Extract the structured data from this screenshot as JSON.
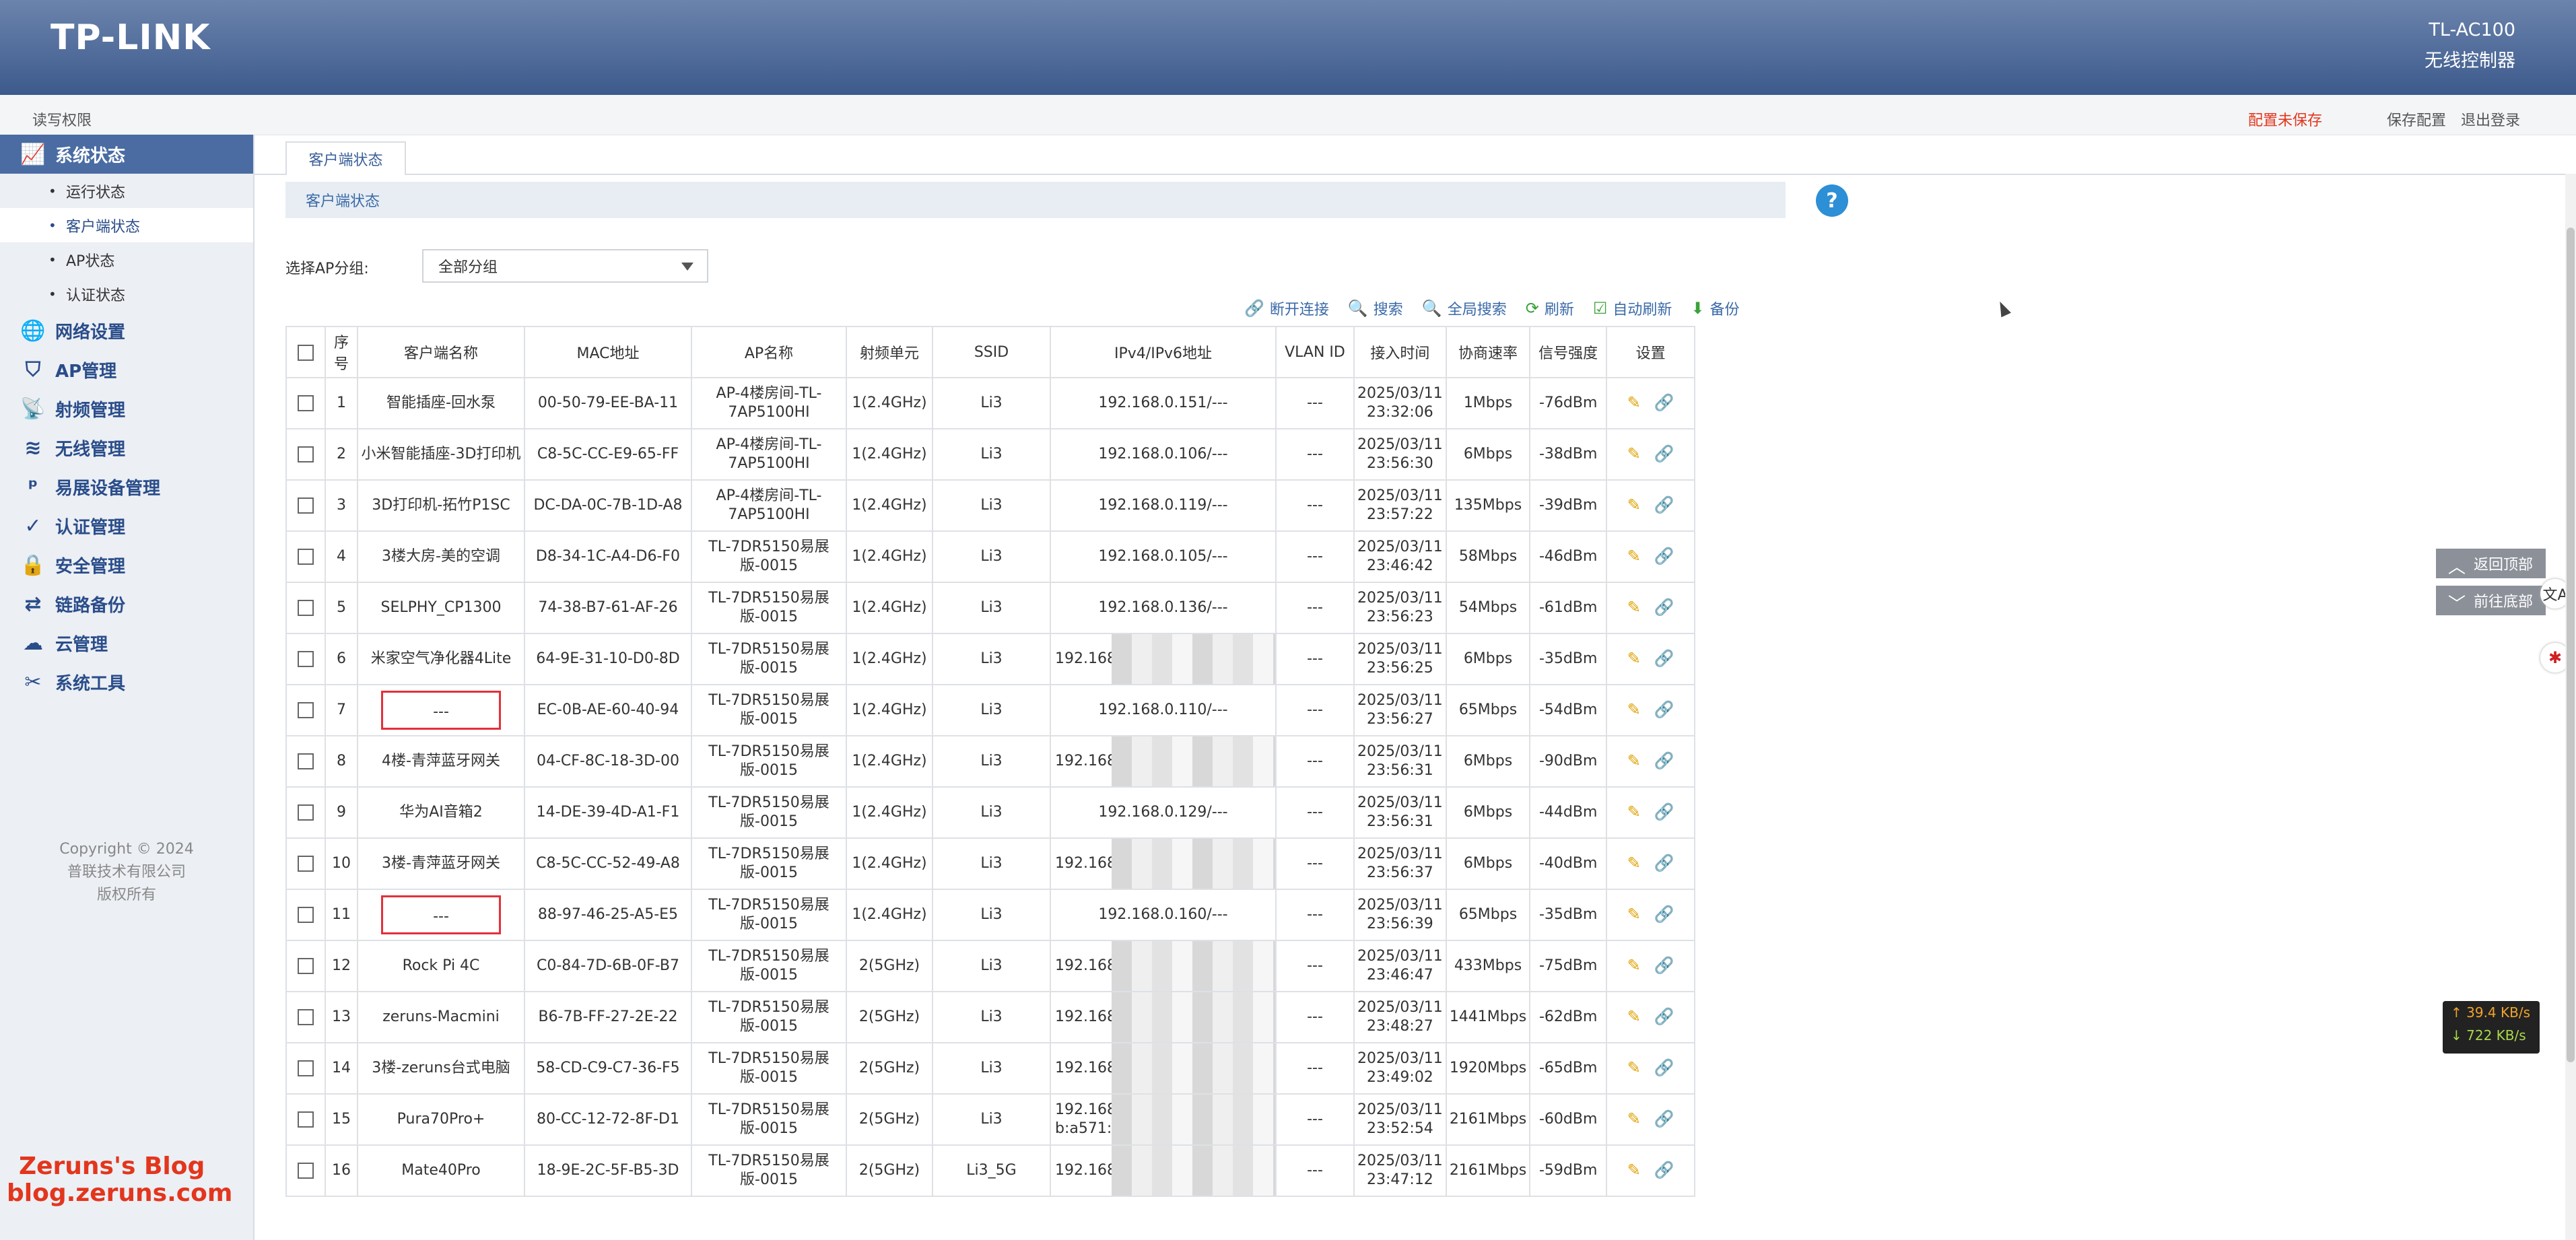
{
  "header": {
    "logo": "TP-LINK",
    "model": "TL-AC100",
    "subtitle": "无线控制器"
  },
  "subbar": {
    "permission": "读写权限",
    "unsaved": "配置未保存",
    "save": "保存配置",
    "logout": "退出登录"
  },
  "sidebar": {
    "items": [
      {
        "label": "系统状态",
        "icon": "chart-line-icon",
        "active": true
      },
      {
        "label": "网络设置",
        "icon": "globe-icon"
      },
      {
        "label": "AP管理",
        "icon": "shield-icon"
      },
      {
        "label": "射频管理",
        "icon": "radio-icon"
      },
      {
        "label": "无线管理",
        "icon": "wifi-icon"
      },
      {
        "label": "易展设备管理",
        "icon": "p-icon"
      },
      {
        "label": "认证管理",
        "icon": "check-shield-icon"
      },
      {
        "label": "安全管理",
        "icon": "lock-icon"
      },
      {
        "label": "链路备份",
        "icon": "shuffle-icon"
      },
      {
        "label": "云管理",
        "icon": "cloud-icon"
      },
      {
        "label": "系统工具",
        "icon": "tools-icon"
      }
    ],
    "subitems": [
      "运行状态",
      "客户端状态",
      "AP状态",
      "认证状态"
    ],
    "copyright": [
      "Copyright © 2024",
      "普联技术有限公司",
      "版权所有"
    ]
  },
  "watermark": {
    "line1": "Zeruns's Blog",
    "line2": "blog.zeruns.com"
  },
  "tabs": {
    "active": "客户端状态"
  },
  "section": {
    "title": "客户端状态"
  },
  "filter": {
    "label": "选择AP分组:",
    "value": "全部分组"
  },
  "toolbar": {
    "disconnect": "断开连接",
    "search": "搜索",
    "global_search": "全局搜索",
    "refresh": "刷新",
    "auto_refresh": "自动刷新",
    "backup": "备份"
  },
  "table": {
    "headers": [
      "序号",
      "客户端名称",
      "MAC地址",
      "AP名称",
      "射频单元",
      "SSID",
      "IPv4/IPv6地址",
      "VLAN ID",
      "接入时间",
      "协商速率",
      "信号强度",
      "设置"
    ],
    "rows": [
      {
        "no": "1",
        "name": "智能插座-回水泵",
        "mac": "00-50-79-EE-BA-11",
        "ap": "AP-4楼房间-TL-7AP5100HI",
        "radio": "1(2.4GHz)",
        "ssid": "Li3",
        "ip": "192.168.0.151/---",
        "vlan": "---",
        "time": "2025/03/11 23:32:06",
        "rate": "1Mbps",
        "signal": "-76dBm"
      },
      {
        "no": "2",
        "name": "小米智能插座-3D打印机",
        "mac": "C8-5C-CC-E9-65-FF",
        "ap": "AP-4楼房间-TL-7AP5100HI",
        "radio": "1(2.4GHz)",
        "ssid": "Li3",
        "ip": "192.168.0.106/---",
        "vlan": "---",
        "time": "2025/03/11 23:56:30",
        "rate": "6Mbps",
        "signal": "-38dBm"
      },
      {
        "no": "3",
        "name": "3D打印机-拓竹P1SC",
        "mac": "DC-DA-0C-7B-1D-A8",
        "ap": "AP-4楼房间-TL-7AP5100HI",
        "radio": "1(2.4GHz)",
        "ssid": "Li3",
        "ip": "192.168.0.119/---",
        "vlan": "---",
        "time": "2025/03/11 23:57:22",
        "rate": "135Mbps",
        "signal": "-39dBm"
      },
      {
        "no": "4",
        "name": "3楼大房-美的空调",
        "mac": "D8-34-1C-A4-D6-F0",
        "ap": "TL-7DR5150易展版-0015",
        "radio": "1(2.4GHz)",
        "ssid": "Li3",
        "ip": "192.168.0.105/---",
        "vlan": "---",
        "time": "2025/03/11 23:46:42",
        "rate": "58Mbps",
        "signal": "-46dBm"
      },
      {
        "no": "5",
        "name": "SELPHY_CP1300",
        "mac": "74-38-B7-61-AF-26",
        "ap": "TL-7DR5150易展版-0015",
        "radio": "1(2.4GHz)",
        "ssid": "Li3",
        "ip": "192.168.0.136/---",
        "vlan": "---",
        "time": "2025/03/11 23:56:23",
        "rate": "54Mbps",
        "signal": "-61dBm"
      },
      {
        "no": "6",
        "name": "米家空气净化器4Lite",
        "mac": "64-9E-31-10-D0-8D",
        "ap": "TL-7DR5150易展版-0015",
        "radio": "1(2.4GHz)",
        "ssid": "Li3",
        "ip": "192.168.0.1 b:a d",
        "vlan": "---",
        "time": "2025/03/11 23:56:25",
        "rate": "6Mbps",
        "signal": "-35dBm",
        "blur": true
      },
      {
        "no": "7",
        "name": "---",
        "mac": "EC-0B-AE-60-40-94",
        "ap": "TL-7DR5150易展版-0015",
        "radio": "1(2.4GHz)",
        "ssid": "Li3",
        "ip": "192.168.0.110/---",
        "vlan": "---",
        "time": "2025/03/11 23:56:27",
        "rate": "65Mbps",
        "signal": "-54dBm",
        "redbox": true
      },
      {
        "no": "8",
        "name": "4楼-青萍蓝牙网关",
        "mac": "04-CF-8C-18-3D-00",
        "ap": "TL-7DR5150易展版-0015",
        "radio": "1(2.4GHz)",
        "ssid": "Li3",
        "ip": "192.168.0.1 cbff",
        "vlan": "---",
        "time": "2025/03/11 23:56:31",
        "rate": "6Mbps",
        "signal": "-90dBm",
        "blur": true
      },
      {
        "no": "9",
        "name": "华为AI音箱2",
        "mac": "14-DE-39-4D-A1-F1",
        "ap": "TL-7DR5150易展版-0015",
        "radio": "1(2.4GHz)",
        "ssid": "Li3",
        "ip": "192.168.0.129/---",
        "vlan": "---",
        "time": "2025/03/11 23:56:31",
        "rate": "6Mbps",
        "signal": "-44dBm"
      },
      {
        "no": "10",
        "name": "3楼-青萍蓝牙网关",
        "mac": "C8-5C-CC-52-49-A8",
        "ap": "TL-7DR5150易展版-0015",
        "radio": "1(2.4GHz)",
        "ssid": "Li3",
        "ip": "192.168.0.154 b:a57. 8",
        "vlan": "---",
        "time": "2025/03/11 23:56:37",
        "rate": "6Mbps",
        "signal": "-40dBm",
        "blur": true
      },
      {
        "no": "11",
        "name": "---",
        "mac": "88-97-46-25-A5-E5",
        "ap": "TL-7DR5150易展版-0015",
        "radio": "1(2.4GHz)",
        "ssid": "Li3",
        "ip": "192.168.0.160/---",
        "vlan": "---",
        "time": "2025/03/11 23:56:39",
        "rate": "65Mbps",
        "signal": "-35dBm",
        "redbox": true
      },
      {
        "no": "12",
        "name": "Rock Pi 4C",
        "mac": "C0-84-7D-6B-0F-B7",
        "ap": "TL-7DR5150易展版-0015",
        "radio": "2(5GHz)",
        "ssid": "Li3",
        "ip": "192.168.0.143/240 0f b:",
        "vlan": "---",
        "time": "2025/03/11 23:46:47",
        "rate": "433Mbps",
        "signal": "-75dBm",
        "blur": true
      },
      {
        "no": "13",
        "name": "zeruns-Macmini",
        "mac": "B6-7B-FF-27-2E-22",
        "ap": "TL-7DR5150易展版-0015",
        "radio": "2(5GHz)",
        "ssid": "Li3",
        "ip": "192.168.0.111/240 0f",
        "vlan": "---",
        "time": "2025/03/11 23:48:27",
        "rate": "1441Mbps",
        "signal": "-62dBm",
        "blur": true
      },
      {
        "no": "14",
        "name": "3楼-zeruns台式电脑",
        "mac": "58-CD-C9-C7-36-F5",
        "ap": "TL-7DR5150易展版-0015",
        "radio": "2(5GHz)",
        "ssid": "Li3",
        "ip": "192.168.0.176/240 0f",
        "vlan": "---",
        "time": "2025/03/11 23:49:02",
        "rate": "1920Mbps",
        "signal": "-65dBm",
        "blur": true
      },
      {
        "no": "15",
        "name": "Pura70Pro+",
        "mac": "80-CC-12-72-8F-D1",
        "ap": "TL-7DR5150易展版-0015",
        "radio": "2(5GHz)",
        "ssid": "Li3",
        "ip": "192.168.0.146/240e:3b f b:a571:c",
        "vlan": "---",
        "time": "2025/03/11 23:52:54",
        "rate": "2161Mbps",
        "signal": "-60dBm",
        "blur": true
      },
      {
        "no": "16",
        "name": "Mate40Pro",
        "mac": "18-9E-2C-5F-B5-3D",
        "ap": "TL-7DR5150易展版-0015",
        "radio": "2(5GHz)",
        "ssid": "Li3_5G",
        "ip": "192.168.0. b:a5 2",
        "vlan": "---",
        "time": "2025/03/11 23:47:12",
        "rate": "2161Mbps",
        "signal": "-59dBm",
        "blur": true
      }
    ]
  },
  "floating": {
    "top": "返回顶部",
    "bottom": "前往底部"
  },
  "speed": {
    "up": "↑ 39.4 KB/s",
    "down": "↓ 722 KB/s"
  },
  "help": "?",
  "colors": {
    "header": "#3d5a8c",
    "accent": "#2a4d8a",
    "alert": "#e2361d"
  }
}
